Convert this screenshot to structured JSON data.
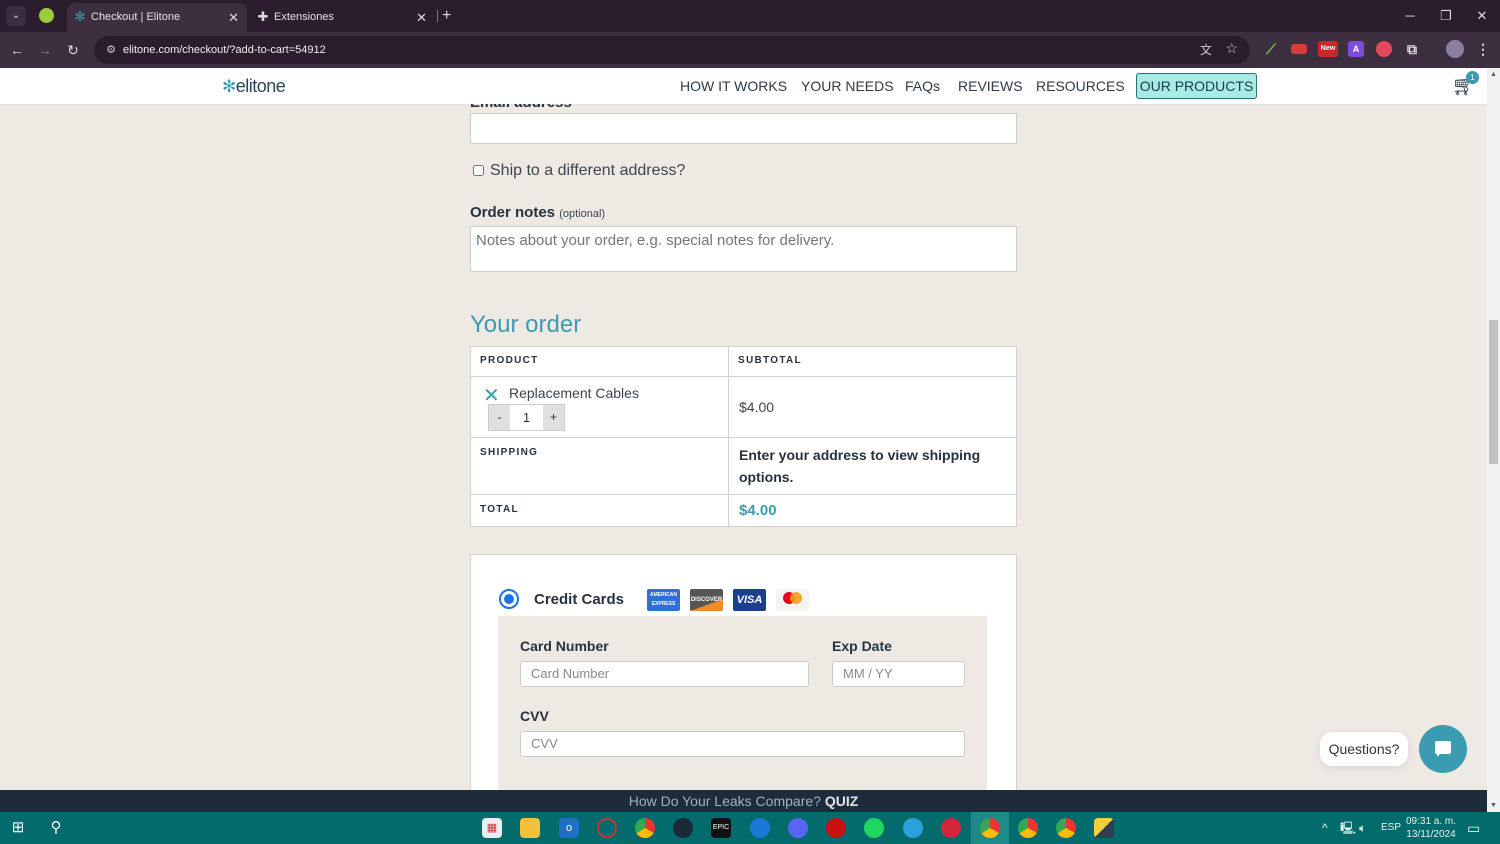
{
  "browser": {
    "tabs": [
      {
        "title": "Checkout | Elitone",
        "icon": "elitone-snowflake-icon",
        "active": true
      },
      {
        "title": "Extensiones",
        "icon": "puzzle-icon",
        "active": false
      }
    ],
    "url": "elitone.com/checkout/?add-to-cart=54912",
    "extensions": [
      {
        "name": "green-extension",
        "color": "#7ec62a"
      },
      {
        "name": "red-extension",
        "color": "#d93a3a"
      },
      {
        "name": "new-extension",
        "color": "#c8282a",
        "label": "New"
      },
      {
        "name": "a-extension",
        "color": "#7c4ddc",
        "label": "A"
      },
      {
        "name": "stripe-extension",
        "color": "#e4475a"
      }
    ]
  },
  "site": {
    "logo": "elitone",
    "nav": [
      "HOW IT WORKS",
      "YOUR NEEDS",
      "FAQs",
      "REVIEWS",
      "RESOURCES"
    ],
    "cta": "OUR PRODUCTS",
    "cart_count": "1"
  },
  "form": {
    "email_label": "Email address",
    "email_value": "",
    "ship_different": "Ship to a different address?",
    "order_notes_label": "Order notes",
    "order_notes_optional": "(optional)",
    "order_notes_placeholder": "Notes about your order, e.g. special notes for delivery."
  },
  "order": {
    "heading": "Your order",
    "col_product": "PRODUCT",
    "col_subtotal": "SUBTOTAL",
    "items": [
      {
        "name": "Replacement Cables",
        "qty": "1",
        "subtotal": "$4.00"
      }
    ],
    "qty_minus": "-",
    "qty_plus": "+",
    "shipping_label": "SHIPPING",
    "shipping_msg": "Enter your address to view shipping options.",
    "total_label": "TOTAL",
    "total_value": "$4.00"
  },
  "payment": {
    "method": "Credit Cards",
    "cards": [
      "AMERICAN EXPRESS",
      "DISCOVER",
      "VISA",
      "mastercard"
    ],
    "card_number_label": "Card Number",
    "card_number_placeholder": "Card Number",
    "exp_label": "Exp Date",
    "exp_placeholder": "MM / YY",
    "cvv_label": "CVV",
    "cvv_placeholder": "CVV"
  },
  "chat": {
    "bubble": "Questions?"
  },
  "promo": {
    "text": "How Do Your Leaks Compare?",
    "link": "QUIZ"
  },
  "taskbar": {
    "apps": [
      "Microsoft Store",
      "File Explorer",
      "Outlook",
      "Opera",
      "Chrome",
      "Steam",
      "Epic Games",
      "Battle.net",
      "Discord",
      "Game app",
      "Spotify",
      "Telegram",
      "Red app",
      "Chrome profile 1",
      "Chrome profile 2",
      "Chrome profile 3",
      "Python"
    ],
    "language": "ESP",
    "time": "09:31 a. m.",
    "date": "13/11/2024"
  }
}
